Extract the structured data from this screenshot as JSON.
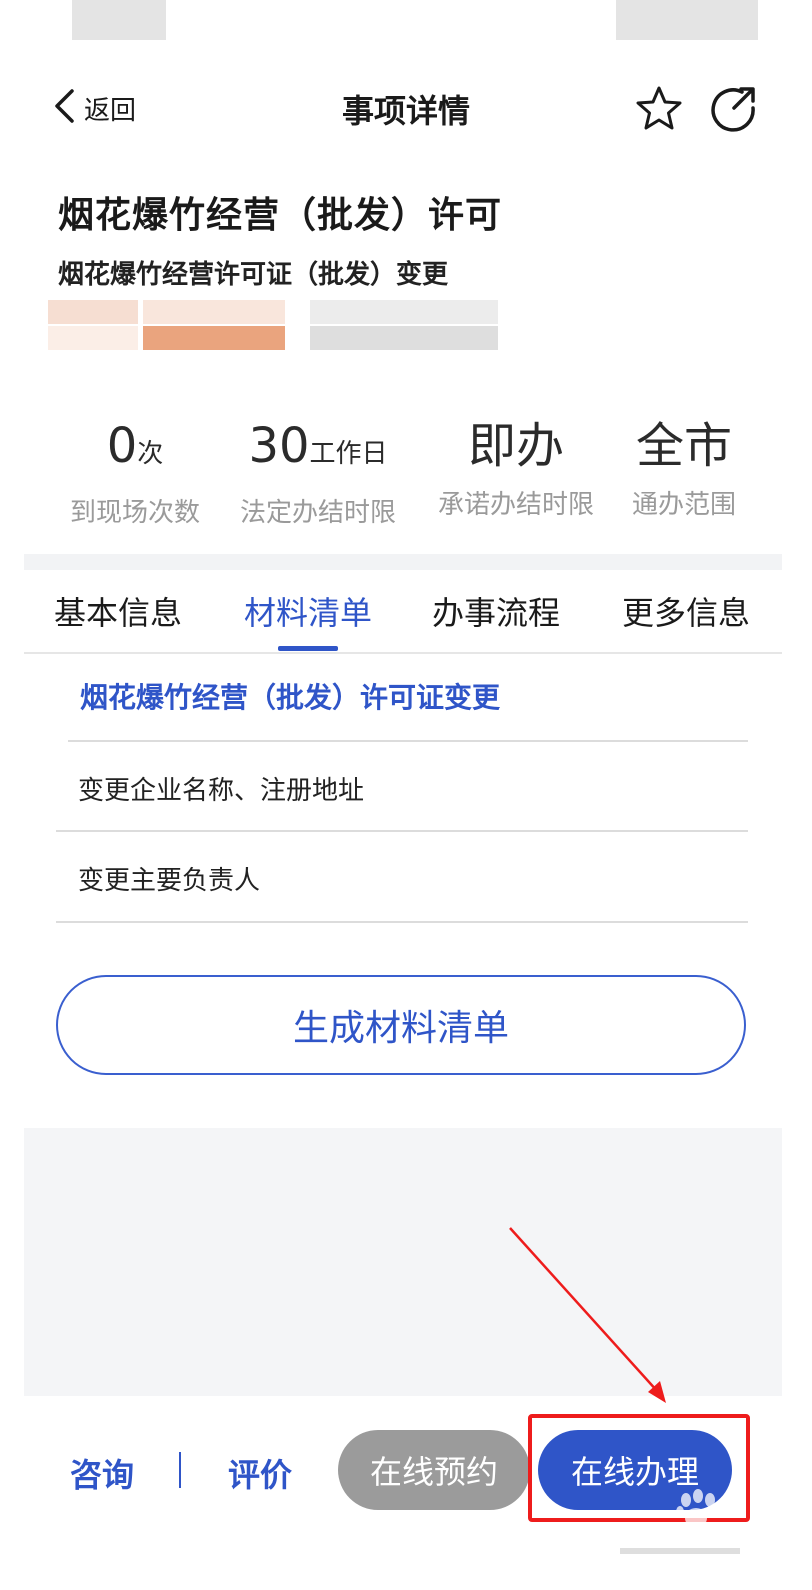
{
  "nav": {
    "back_label": "返回",
    "title": "事项详情"
  },
  "item": {
    "title": "烟花爆竹经营（批发）许可",
    "subtitle": "烟花爆竹经营许可证（批发）变更"
  },
  "stats": [
    {
      "value": "0",
      "unit": "次",
      "label": "到现场次数"
    },
    {
      "value": "30",
      "unit": "工作日",
      "label": "法定办结时限"
    },
    {
      "value": "即办",
      "unit": "",
      "label": "承诺办结时限"
    },
    {
      "value": "全市",
      "unit": "",
      "label": "通办范围"
    }
  ],
  "tabs": [
    {
      "label": "基本信息",
      "active": false
    },
    {
      "label": "材料清单",
      "active": true
    },
    {
      "label": "办事流程",
      "active": false
    },
    {
      "label": "更多信息",
      "active": false
    }
  ],
  "materials": {
    "heading": "烟花爆竹经营（批发）许可证变更",
    "items": [
      "变更企业名称、注册地址",
      "变更主要负责人"
    ],
    "generate_button": "生成材料清单"
  },
  "bottom_bar": {
    "consult": "咨询",
    "rate": "评价",
    "reserve": "在线预约",
    "handle": "在线办理"
  },
  "colors": {
    "accent": "#2f55c8",
    "annotation": "#ee1c1c",
    "disabled": "#9b9b9b"
  }
}
